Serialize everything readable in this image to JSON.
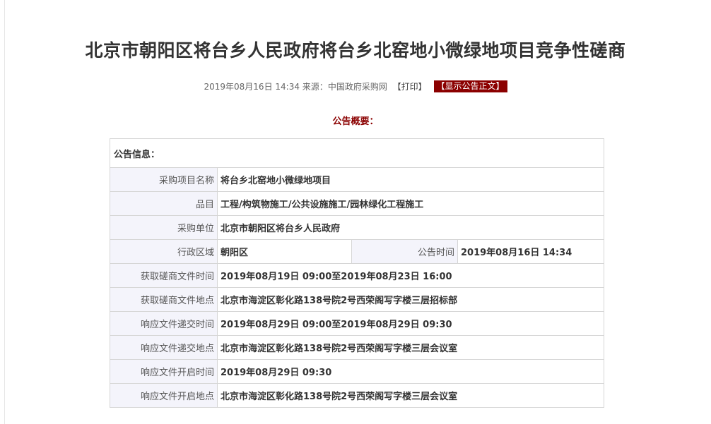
{
  "header": {
    "title": "北京市朝阳区将台乡人民政府将台乡北窑地小微绿地项目竞争性磋商",
    "date": "2019年08月16日 14:34",
    "source_label": "来源：",
    "source": "中国政府采购网",
    "print_label": "【打印】",
    "show_full_label": "【显示公告正文】"
  },
  "summary_heading": "公告概要：",
  "info": {
    "section_label": "公告信息：",
    "rows": [
      {
        "label": "采购项目名称",
        "value": "将台乡北窑地小微绿地项目"
      },
      {
        "label": "品目",
        "value": "工程/构筑物施工/公共设施施工/园林绿化工程施工"
      },
      {
        "label": "采购单位",
        "value": "北京市朝阳区将台乡人民政府"
      },
      {
        "label": "行政区域",
        "value": "朝阳区",
        "label2": "公告时间",
        "value2": "2019年08月16日 14:34"
      },
      {
        "label": "获取磋商文件时间",
        "value": "2019年08月19日 09:00至2019年08月23日 16:00"
      },
      {
        "label": "获取磋商文件地点",
        "value": "北京市海淀区彰化路138号院2号西荣阁写字楼三层招标部"
      },
      {
        "label": "响应文件递交时间",
        "value": "2019年08月29日 09:00至2019年08月29日 09:30"
      },
      {
        "label": "响应文件递交地点",
        "value": "北京市海淀区彰化路138号院2号西荣阁写字楼三层会议室"
      },
      {
        "label": "响应文件开启时间",
        "value": "2019年08月29日 09:30"
      },
      {
        "label": "响应文件开启地点",
        "value": "北京市海淀区彰化路138号院2号西荣阁写字楼三层会议室"
      }
    ]
  }
}
